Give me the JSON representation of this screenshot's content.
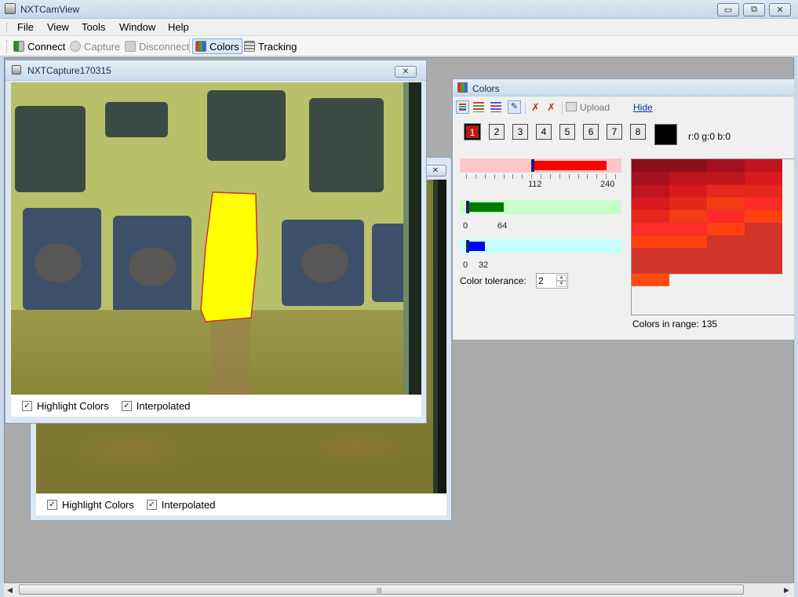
{
  "app": {
    "title": "NXTCamView",
    "window_buttons": {
      "minimize": "▭",
      "restore": "⧉",
      "close": "✕"
    }
  },
  "menu": [
    "File",
    "View",
    "Tools",
    "Window",
    "Help"
  ],
  "toolbar": {
    "connect": "Connect",
    "capture": "Capture",
    "disconnect": "Disconnect",
    "colors": "Colors",
    "tracking": "Tracking"
  },
  "capture_front": {
    "title": "NXTCapture170315",
    "highlight": "Highlight Colors",
    "interpolated": "Interpolated"
  },
  "capture_back": {
    "highlight": "Highlight Colors",
    "interpolated": "Interpolated"
  },
  "colors_panel": {
    "title": "Colors",
    "upload": "Upload",
    "hide": "Hide",
    "slots": [
      "1",
      "2",
      "3",
      "4",
      "5",
      "6",
      "7",
      "8"
    ],
    "rgb_readout": "r:0 g:0 b:0",
    "tolerance_label": "Color tolerance:",
    "tolerance_value": "2",
    "colors_in_range": "Colors in range: 135",
    "red": {
      "min": 112,
      "max": 240,
      "min_label": "112",
      "max_label": "240"
    },
    "green": {
      "min": 0,
      "max": 64,
      "min_label": "0",
      "max_label": "64"
    },
    "blue": {
      "min": 0,
      "max": 32,
      "min_label": "0",
      "max_label": "32"
    },
    "swatch_color": "#000000",
    "accent_colors": {
      "red": "#ff0000",
      "green": "#007a00",
      "blue": "#0000ff",
      "highlight": "#ffff00"
    }
  }
}
